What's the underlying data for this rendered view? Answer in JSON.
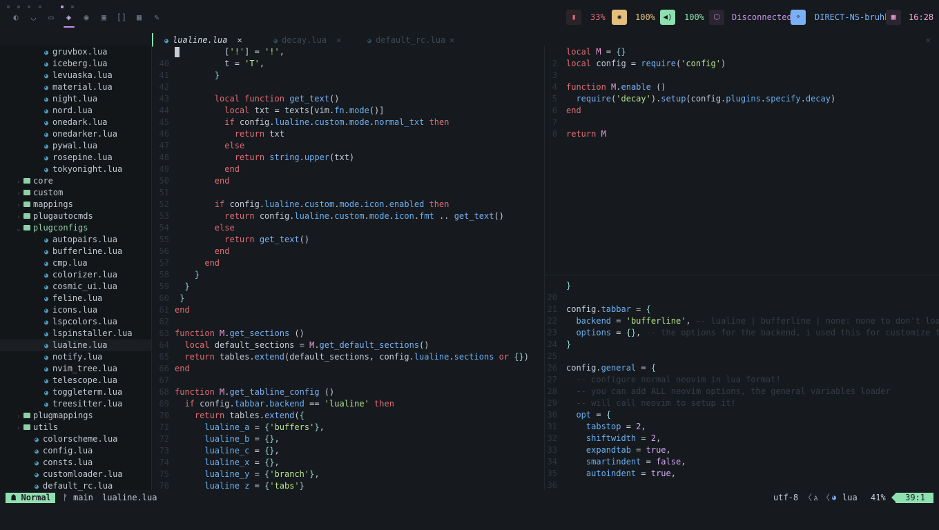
{
  "topbar": {
    "workspaces": [
      {
        "icon": "firefox-icon",
        "glyph": "◐"
      },
      {
        "icon": "pocket-icon",
        "glyph": "◡"
      },
      {
        "icon": "terminal-icon",
        "glyph": "▭"
      },
      {
        "icon": "layers-icon",
        "glyph": "◈",
        "active": true
      },
      {
        "icon": "compass-icon",
        "glyph": "◉"
      },
      {
        "icon": "chat-icon",
        "glyph": "▣"
      },
      {
        "icon": "sidebar-icon",
        "glyph": "[]"
      },
      {
        "icon": "grid-icon",
        "glyph": "▦"
      },
      {
        "icon": "pen-icon",
        "glyph": "✎"
      }
    ],
    "battery": {
      "value": "33%",
      "icon": "battery-icon",
      "color": "#e06c75"
    },
    "brightness": {
      "value": "100%",
      "icon": "brightness-icon",
      "color": "#e5c07b"
    },
    "volume": {
      "value": "100%",
      "icon": "volume-icon",
      "color": "#8fe0b0"
    },
    "vpn": {
      "value": "Disconnected",
      "icon": "box-icon",
      "color": "#c792ea"
    },
    "wifi": {
      "value": "DIRECT-NS-bruhh",
      "icon": "wifi-icon",
      "color": "#7ab0f5"
    },
    "clock": {
      "value": "16:28",
      "icon": "calendar-icon",
      "color": "#f5a8d8"
    }
  },
  "tabs": [
    {
      "label": "lualine.lua",
      "active": true
    },
    {
      "label": "decay.lua",
      "active": false
    },
    {
      "label": "default_rc.lua",
      "active": false
    }
  ],
  "tree": [
    {
      "type": "file",
      "depth": 2,
      "name": "gruvbox.lua"
    },
    {
      "type": "file",
      "depth": 2,
      "name": "iceberg.lua"
    },
    {
      "type": "file",
      "depth": 2,
      "name": "levuaska.lua"
    },
    {
      "type": "file",
      "depth": 2,
      "name": "material.lua"
    },
    {
      "type": "file",
      "depth": 2,
      "name": "night.lua"
    },
    {
      "type": "file",
      "depth": 2,
      "name": "nord.lua"
    },
    {
      "type": "file",
      "depth": 2,
      "name": "onedark.lua"
    },
    {
      "type": "file",
      "depth": 2,
      "name": "onedarker.lua"
    },
    {
      "type": "file",
      "depth": 2,
      "name": "pywal.lua"
    },
    {
      "type": "file",
      "depth": 2,
      "name": "rosepine.lua"
    },
    {
      "type": "file",
      "depth": 2,
      "name": "tokyonight.lua"
    },
    {
      "type": "dir",
      "depth": 1,
      "name": "core",
      "open": false
    },
    {
      "type": "dir",
      "depth": 1,
      "name": "custom",
      "open": false
    },
    {
      "type": "dir",
      "depth": 1,
      "name": "mappings",
      "open": false
    },
    {
      "type": "dir",
      "depth": 1,
      "name": "plugautocmds",
      "open": false
    },
    {
      "type": "dir",
      "depth": 1,
      "name": "plugconfigs",
      "open": true
    },
    {
      "type": "file",
      "depth": 2,
      "name": "autopairs.lua"
    },
    {
      "type": "file",
      "depth": 2,
      "name": "bufferline.lua"
    },
    {
      "type": "file",
      "depth": 2,
      "name": "cmp.lua"
    },
    {
      "type": "file",
      "depth": 2,
      "name": "colorizer.lua"
    },
    {
      "type": "file",
      "depth": 2,
      "name": "cosmic_ui.lua"
    },
    {
      "type": "file",
      "depth": 2,
      "name": "feline.lua"
    },
    {
      "type": "file",
      "depth": 2,
      "name": "icons.lua"
    },
    {
      "type": "file",
      "depth": 2,
      "name": "lspcolors.lua"
    },
    {
      "type": "file",
      "depth": 2,
      "name": "lspinstaller.lua"
    },
    {
      "type": "file",
      "depth": 2,
      "name": "lualine.lua",
      "selected": true
    },
    {
      "type": "file",
      "depth": 2,
      "name": "notify.lua"
    },
    {
      "type": "file",
      "depth": 2,
      "name": "nvim_tree.lua"
    },
    {
      "type": "file",
      "depth": 2,
      "name": "telescope.lua"
    },
    {
      "type": "file",
      "depth": 2,
      "name": "toggleterm.lua"
    },
    {
      "type": "file",
      "depth": 2,
      "name": "treesitter.lua"
    },
    {
      "type": "dir",
      "depth": 1,
      "name": "plugmappings",
      "open": false
    },
    {
      "type": "dir",
      "depth": 1,
      "name": "utils",
      "open": false
    },
    {
      "type": "file",
      "depth": 1,
      "name": "colorscheme.lua"
    },
    {
      "type": "file",
      "depth": 1,
      "name": "config.lua"
    },
    {
      "type": "file",
      "depth": 1,
      "name": "consts.lua"
    },
    {
      "type": "file",
      "depth": 1,
      "name": "customloader.lua"
    },
    {
      "type": "file",
      "depth": 1,
      "name": "default_rc.lua"
    }
  ],
  "pane_main": [
    {
      "n": "",
      "h": "          [<s>'!'</s>] = <s>'!'</s>,",
      "cursor": true
    },
    {
      "n": "40",
      "h": "          t = <s>'T'</s>,"
    },
    {
      "n": "41",
      "h": "        <p>}</p>"
    },
    {
      "n": "42",
      "h": ""
    },
    {
      "n": "43",
      "h": "        <k>local</k> <k>function</k> <f>get_text</f>()"
    },
    {
      "n": "44",
      "h": "          <k>local</k> txt = texts[vim.<d>fn</d>.<d>mode</d>()]"
    },
    {
      "n": "45",
      "h": "          <k>if</k> config.<d>lualine</d>.<d>custom</d>.<d>mode</d>.<d>normal_txt</d> <k>then</k>"
    },
    {
      "n": "46",
      "h": "            <k>return</k> txt"
    },
    {
      "n": "47",
      "h": "          <k>else</k>"
    },
    {
      "n": "48",
      "h": "            <k>return</k> <f>string</f>.<d>upper</d>(txt)"
    },
    {
      "n": "49",
      "h": "          <k>end</k>"
    },
    {
      "n": "50",
      "h": "        <k>end</k>"
    },
    {
      "n": "51",
      "h": ""
    },
    {
      "n": "52",
      "h": "        <k>if</k> config.<d>lualine</d>.<d>custom</d>.<d>mode</d>.<d>icon</d>.<d>enabled</d> <k>then</k>"
    },
    {
      "n": "53",
      "h": "          <k>return</k> config.<d>lualine</d>.<d>custom</d>.<d>mode</d>.<d>icon</d>.<d>fmt</d> .. <f>get_text</f>()"
    },
    {
      "n": "54",
      "h": "        <k>else</k>"
    },
    {
      "n": "55",
      "h": "          <k>return</k> <f>get_text</f>()"
    },
    {
      "n": "56",
      "h": "        <k>end</k>"
    },
    {
      "n": "57",
      "h": "      <k>end</k>"
    },
    {
      "n": "58",
      "h": "    <p>}</p>"
    },
    {
      "n": "59",
      "h": "  <p>}</p>"
    },
    {
      "n": "60",
      "h": " <p>}</p>"
    },
    {
      "n": "61",
      "h": "<k>end</k>"
    },
    {
      "n": "62",
      "h": ""
    },
    {
      "n": "63",
      "h": "<k>function</k> <v>M</v>.<f>get_sections</f> ()"
    },
    {
      "n": "64",
      "h": "  <k>local</k> default_sections = <v>M</v>.<f>get_default_sections</f>()"
    },
    {
      "n": "65",
      "h": "  <k>return</k> tables.<f>extend</f>(default_sections, config.<d>lualine</d>.<d>sections</d> <k>or</k> <p>{}</p>)"
    },
    {
      "n": "66",
      "h": "<k>end</k>"
    },
    {
      "n": "67",
      "h": ""
    },
    {
      "n": "68",
      "h": "<k>function</k> <v>M</v>.<f>get_tabline_config</f> ()"
    },
    {
      "n": "69",
      "h": "  <k>if</k> config.<d>tabbar</d>.<d>backend</d> == <s>'lualine'</s> <k>then</k>"
    },
    {
      "n": "70",
      "h": "    <k>return</k> tables.<f>extend</f>(<p>{</p>"
    },
    {
      "n": "71",
      "h": "      <d>lualine_a</d> = <p>{</p><s>'buffers'</s><p>}</p>,"
    },
    {
      "n": "72",
      "h": "      <d>lualine_b</d> = <p>{}</p>,"
    },
    {
      "n": "73",
      "h": "      <d>lualine_c</d> = <p>{}</p>,"
    },
    {
      "n": "74",
      "h": "      <d>lualine_x</d> = <p>{}</p>,"
    },
    {
      "n": "75",
      "h": "      <d>lualine_y</d> = <p>{</p><s>'branch'</s><p>}</p>,"
    },
    {
      "n": "76",
      "h": "      <d>lualine_z</d> = <p>{</p><s>'tabs'</s><p>}</p>"
    }
  ],
  "pane_top": [
    {
      "n": "",
      "h": "<k>local</k> <v>M</v> = <p>{}</p>"
    },
    {
      "n": "2",
      "h": "<k>local</k> config = <f>require</f>(<s>'config'</s>)"
    },
    {
      "n": "3",
      "h": ""
    },
    {
      "n": "4",
      "h": "<k>function</k> <v>M</v>.<f>enable</f> ()"
    },
    {
      "n": "5",
      "h": "  <f>require</f>(<s>'decay'</s>).<f>setup</f>(config.<d>plugins</d>.<d>specify</d>.<d>decay</d>)"
    },
    {
      "n": "6",
      "h": "<k>end</k>"
    },
    {
      "n": "7",
      "h": ""
    },
    {
      "n": "8",
      "h": "<k>return</k> <v>M</v>"
    }
  ],
  "pane_bot": [
    {
      "n": "",
      "h": "<p>}</p>"
    },
    {
      "n": "20",
      "h": ""
    },
    {
      "n": "21",
      "h": "config.<d>tabbar</d> = <p>{</p>"
    },
    {
      "n": "22",
      "h": "  <d>backend</d> = <s>'bufferline'</s>, <c>-- lualine | bufferline | none: none to don't load</c>"
    },
    {
      "n": "23",
      "h": "  <d>options</d> = <p>{}</p>, <c>-- the options for the backend, i used this for customize th</c>"
    },
    {
      "n": "24",
      "h": "<p>}</p>"
    },
    {
      "n": "25",
      "h": ""
    },
    {
      "n": "26",
      "h": "config.<d>general</d> = <p>{</p>"
    },
    {
      "n": "27",
      "h": "  <c>-- configure normal neovim in lua format!</c>"
    },
    {
      "n": "28",
      "h": "  <c>-- you can add ALL neovim options, the general variables loader</c>"
    },
    {
      "n": "29",
      "h": "  <c>-- will call neovim to setup it!</c>"
    },
    {
      "n": "30",
      "h": "  <d>opt</d> = <p>{</p>"
    },
    {
      "n": "31",
      "h": "    <d>tabstop</d> = <n>2</n>,"
    },
    {
      "n": "32",
      "h": "    <d>shiftwidth</d> = <n>2</n>,"
    },
    {
      "n": "33",
      "h": "    <d>expandtab</d> = <n>true</n>,"
    },
    {
      "n": "34",
      "h": "    <d>smartindent</d> = <n>false</n>,"
    },
    {
      "n": "35",
      "h": "    <d>autoindent</d> = <n>true</n>,"
    },
    {
      "n": "36",
      "h": ""
    }
  ],
  "statusline": {
    "mode": "Normal",
    "branch": "main",
    "filename": "lualine.lua",
    "encoding": "utf-8",
    "filetype": "lua",
    "percent": "41%",
    "position": "39:1"
  }
}
